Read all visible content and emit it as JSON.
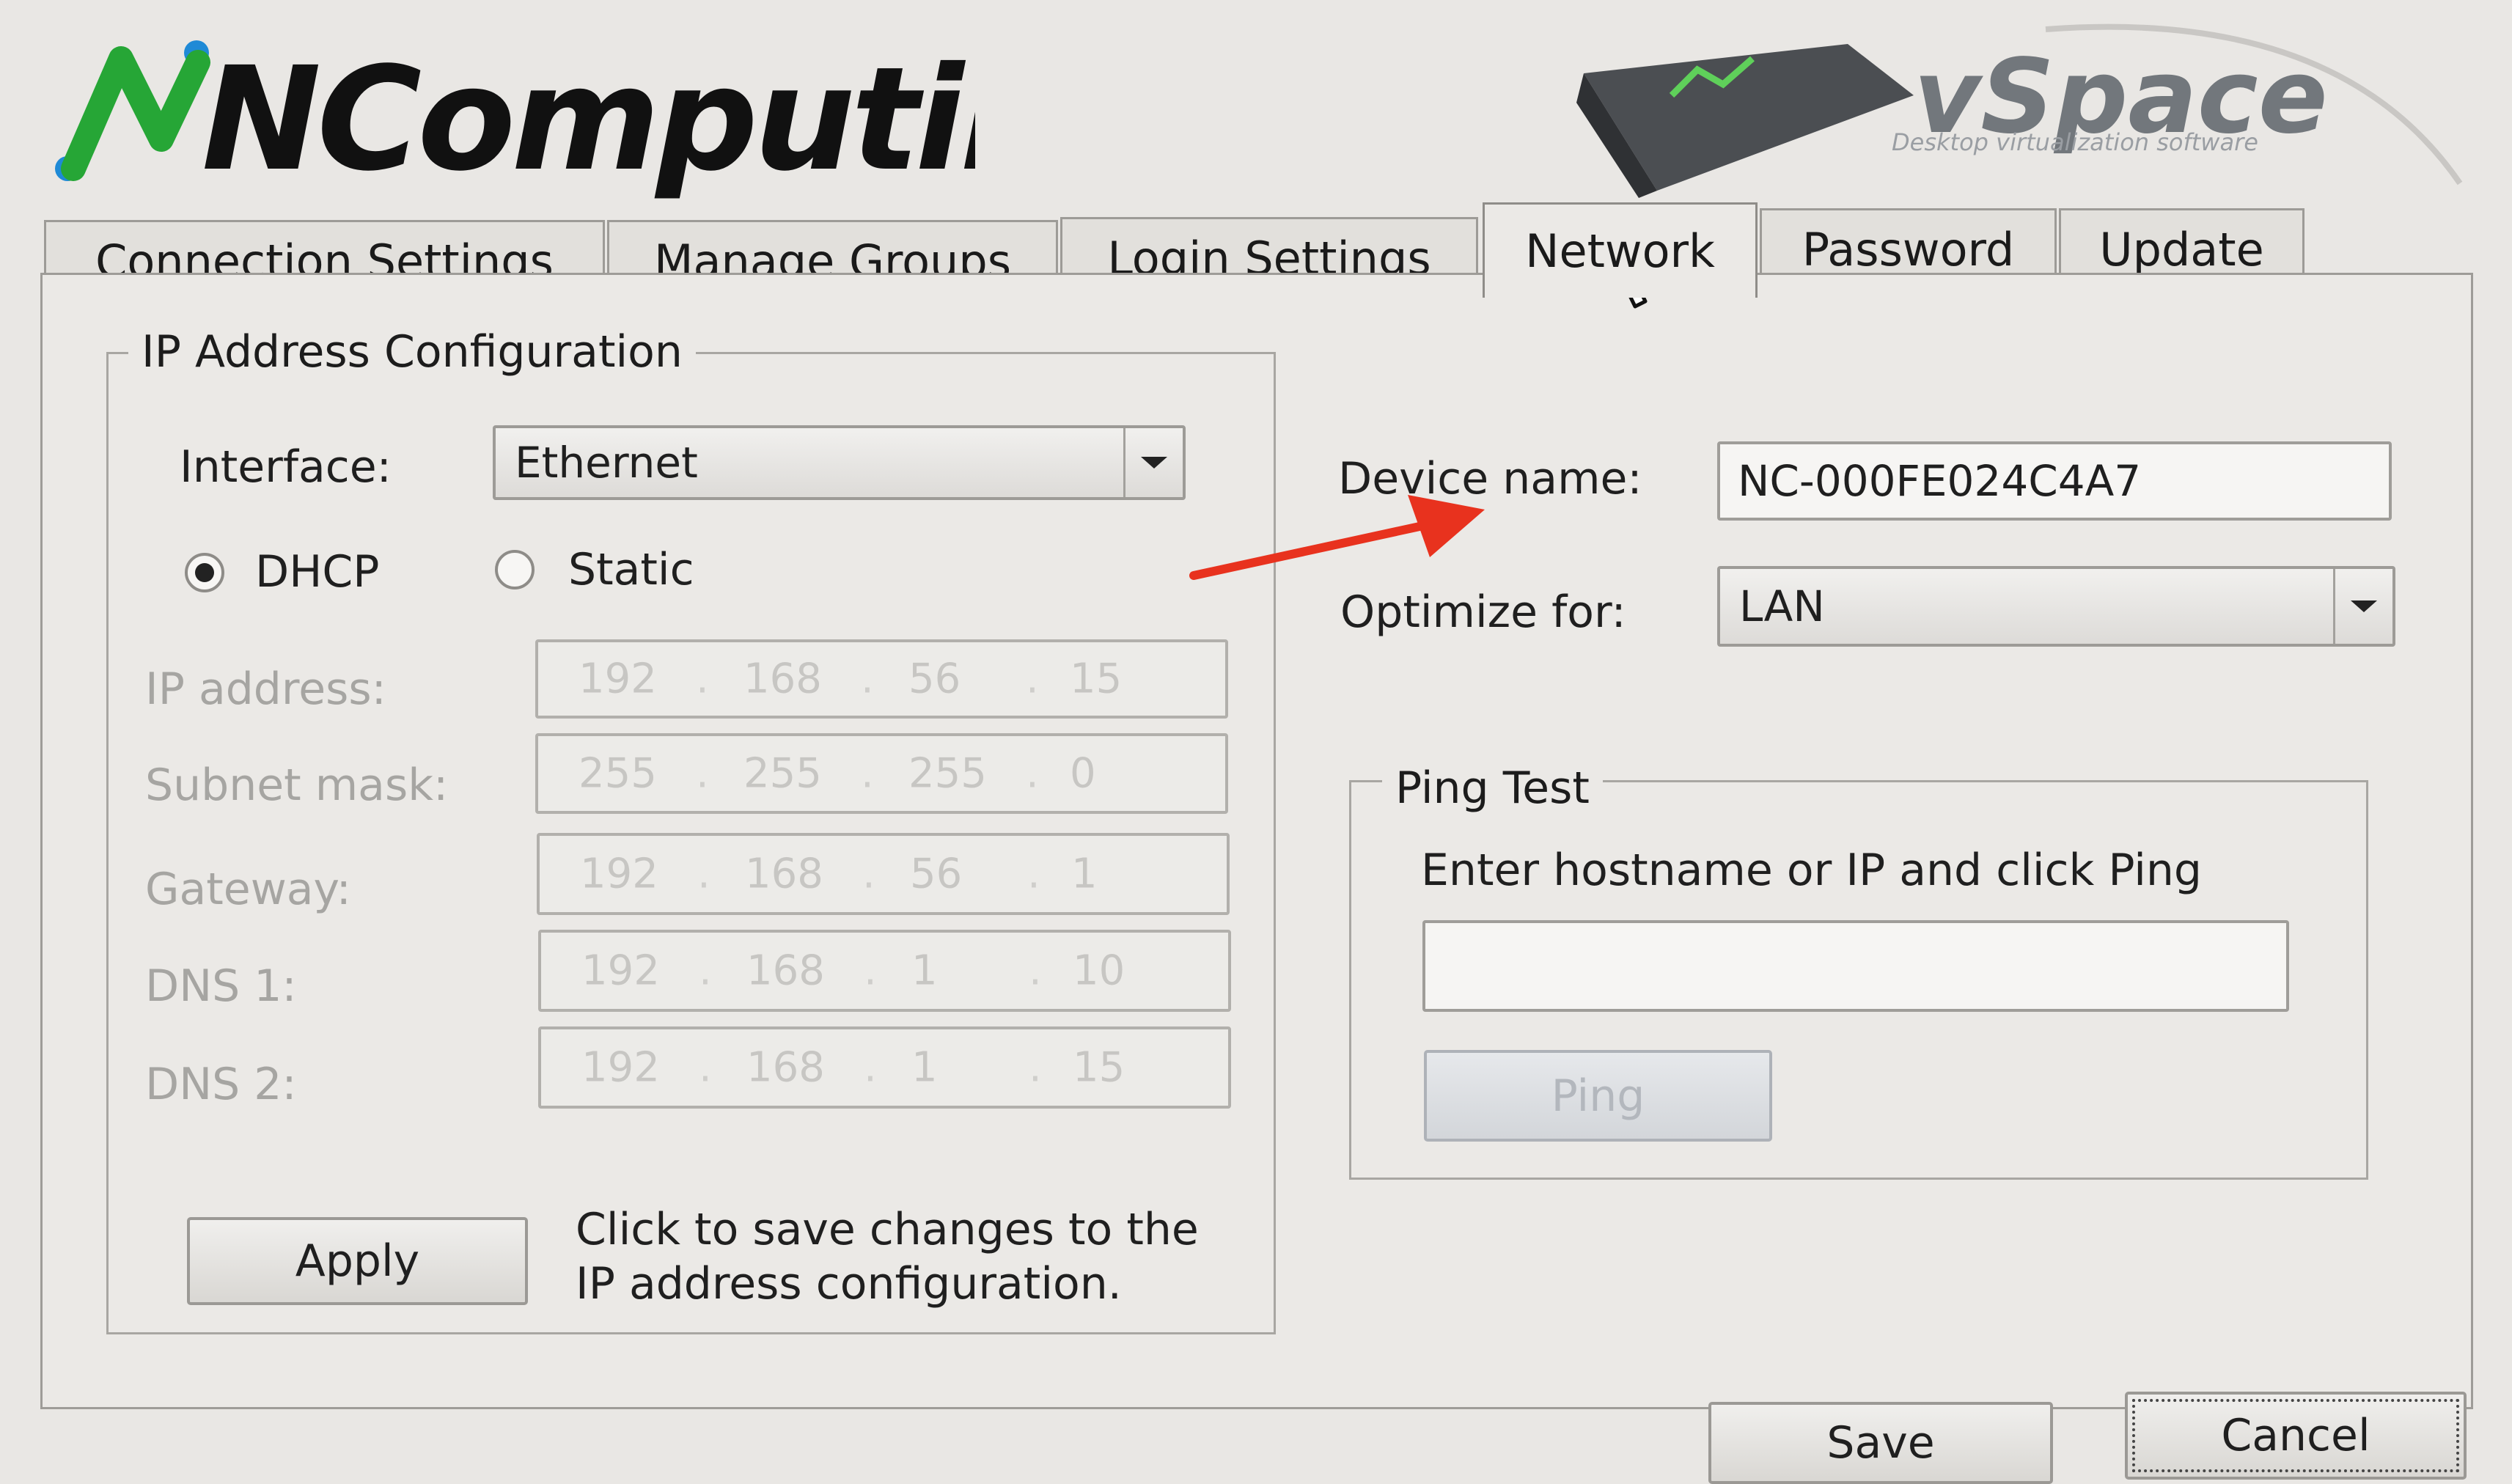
{
  "header": {
    "logo_text": "NComputing",
    "product_name": "vSpace",
    "product_tagline": "Desktop virtualization software"
  },
  "tabs": [
    {
      "label": "Connection Settings"
    },
    {
      "label": "Manage Groups"
    },
    {
      "label": "Login Settings"
    },
    {
      "label": "Network",
      "active": true
    },
    {
      "label": "Password"
    },
    {
      "label": "Update"
    }
  ],
  "ip_config": {
    "legend": "IP Address Configuration",
    "interface_label": "Interface:",
    "interface_value": "Ethernet",
    "dhcp_label": "DHCP",
    "static_label": "Static",
    "mode_selected": "DHCP",
    "ip_label": "IP address:",
    "ip_address": [
      "192",
      "168",
      "56",
      "15"
    ],
    "subnet_label": "Subnet mask:",
    "subnet_mask": [
      "255",
      "255",
      "255",
      "0"
    ],
    "gateway_label": "Gateway:",
    "gateway": [
      "192",
      "168",
      "56",
      "1"
    ],
    "dns1_label": "DNS 1:",
    "dns1": [
      "192",
      "168",
      "1",
      "10"
    ],
    "dns2_label": "DNS 2:",
    "dns2": [
      "192",
      "168",
      "1",
      "15"
    ],
    "apply_label": "Apply",
    "apply_hint_line1": "Click to save changes to the",
    "apply_hint_line2": "IP address configuration."
  },
  "device": {
    "name_label": "Device name:",
    "name_value": "NC-000FE024C4A7",
    "optimize_label": "Optimize for:",
    "optimize_value": "LAN"
  },
  "ping": {
    "legend": "Ping Test",
    "instruction": "Enter hostname or IP and click Ping",
    "input_value": "",
    "button_label": "Ping"
  },
  "footer": {
    "save_label": "Save",
    "cancel_label": "Cancel"
  },
  "colors": {
    "brand_green": "#26a636",
    "brand_blue": "#1f8ad6",
    "annotation_arrow": "#e8321e"
  },
  "icons": [
    "mouse-cursor-icon",
    "annotation-arrow-icon",
    "dropdown-arrow-icon"
  ]
}
